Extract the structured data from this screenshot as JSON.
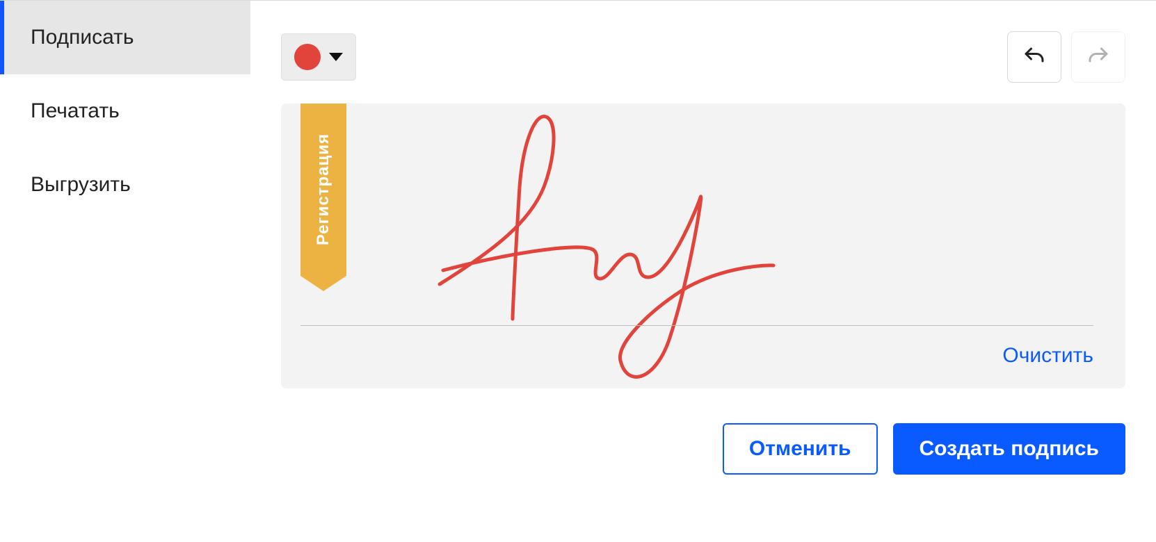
{
  "sidebar": {
    "items": [
      {
        "label": "Подписать",
        "active": true
      },
      {
        "label": "Печатать",
        "active": false
      },
      {
        "label": "Выгрузить",
        "active": false
      }
    ]
  },
  "toolbar": {
    "color": "#e2433a"
  },
  "ribbon": {
    "label": "Регистрация"
  },
  "canvas": {
    "clear_label": "Очистить"
  },
  "footer": {
    "cancel_label": "Отменить",
    "create_label": "Создать подпись"
  }
}
